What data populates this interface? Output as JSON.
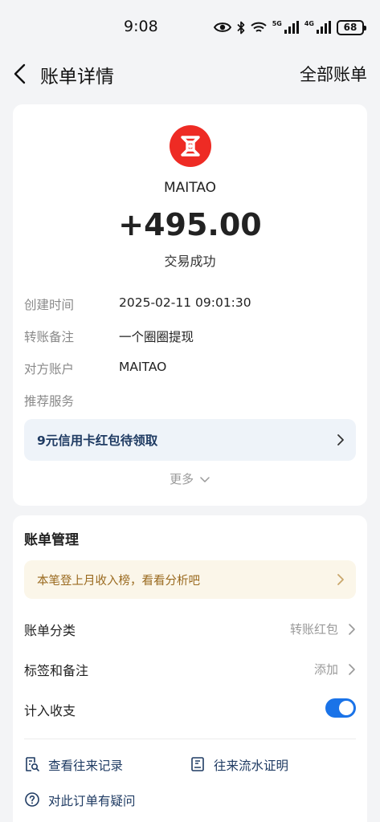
{
  "status_bar": {
    "time": "9:08",
    "net1": "5G",
    "net2": "4G",
    "battery": "68",
    "icons": [
      "eye-icon",
      "bluetooth-icon",
      "wifi-icon",
      "signal-icon",
      "signal-icon",
      "battery-icon"
    ]
  },
  "nav": {
    "title": "账单详情",
    "right_label": "全部账单"
  },
  "transaction": {
    "merchant": "MAITAO",
    "amount": "+495.00",
    "status": "交易成功",
    "logo_color": "#ee2b24"
  },
  "details": [
    {
      "label": "创建时间",
      "value": "2025-02-11 09:01:30"
    },
    {
      "label": "转账备注",
      "value": "一个圈圈提现"
    },
    {
      "label": "对方账户",
      "value": "MAITAO"
    },
    {
      "label": "推荐服务",
      "value": ""
    }
  ],
  "promo": {
    "text": "9元信用卡红包待领取"
  },
  "more_label": "更多",
  "management": {
    "title": "账单管理",
    "banner": "本笔登上月收入榜，看看分析吧",
    "rows": [
      {
        "label": "账单分类",
        "value": "转账红包"
      },
      {
        "label": "标签和备注",
        "value": "添加"
      },
      {
        "label": "计入收支",
        "value": ""
      }
    ],
    "toggle_on": true,
    "links": [
      "查看往来记录",
      "往来流水证明",
      "对此订单有疑问"
    ]
  },
  "colors": {
    "accent": "#1a73e8",
    "link": "#1f3b63",
    "banner_text": "#9a6a1f",
    "banner_bg": "#fbf6e9",
    "promo_bg": "#eef3f9"
  }
}
